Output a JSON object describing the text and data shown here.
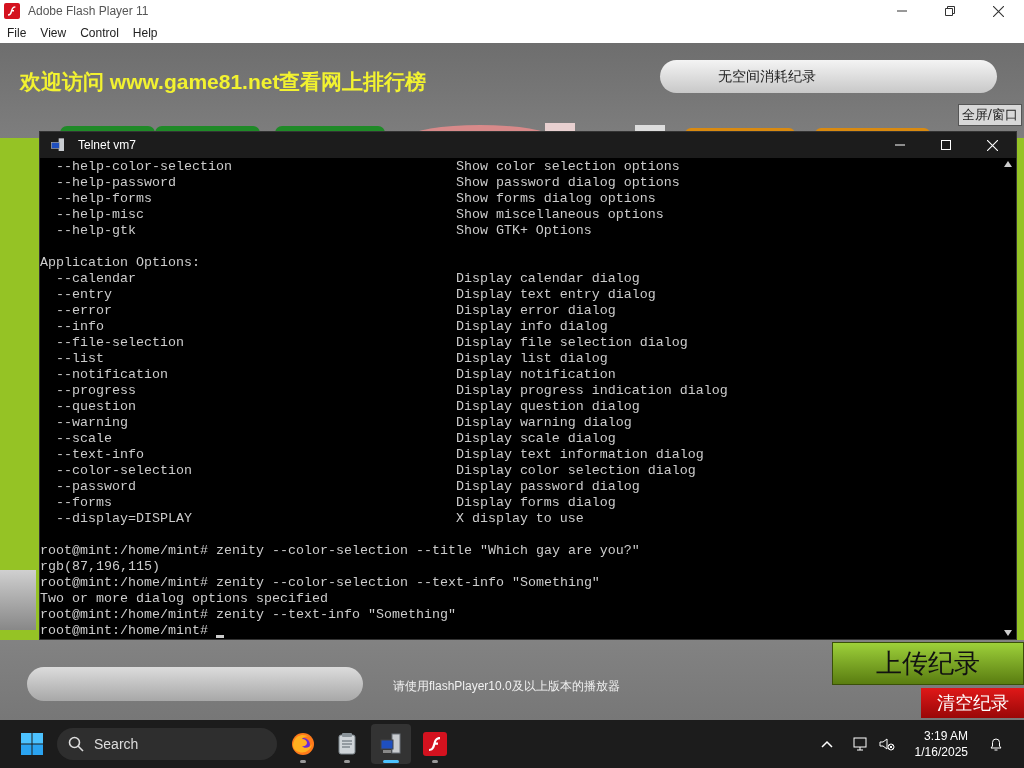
{
  "app_window": {
    "title": "Adobe Flash Player 11",
    "menu": [
      "File",
      "View",
      "Control",
      "Help"
    ]
  },
  "game": {
    "banner": "欢迎访问 www.game81.net查看网上排行榜",
    "record_field": "无空间消耗纪录",
    "fullscreen_button": "全屏/窗口",
    "notice": "请使用flashPlayer10.0及以上版本的播放器",
    "upload_button": "上传纪录",
    "clear_button": "清空纪录"
  },
  "terminal": {
    "title": "Telnet vm7",
    "lines": [
      {
        "kind": "option",
        "option": "--help-color-selection",
        "description": "Show color selection options"
      },
      {
        "kind": "option",
        "option": "--help-password",
        "description": "Show password dialog options"
      },
      {
        "kind": "option",
        "option": "--help-forms",
        "description": "Show forms dialog options"
      },
      {
        "kind": "option",
        "option": "--help-misc",
        "description": "Show miscellaneous options"
      },
      {
        "kind": "option",
        "option": "--help-gtk",
        "description": "Show GTK+ Options"
      },
      {
        "kind": "blank"
      },
      {
        "kind": "text",
        "text": "Application Options:"
      },
      {
        "kind": "option",
        "option": "--calendar",
        "description": "Display calendar dialog"
      },
      {
        "kind": "option",
        "option": "--entry",
        "description": "Display text entry dialog"
      },
      {
        "kind": "option",
        "option": "--error",
        "description": "Display error dialog"
      },
      {
        "kind": "option",
        "option": "--info",
        "description": "Display info dialog"
      },
      {
        "kind": "option",
        "option": "--file-selection",
        "description": "Display file selection dialog"
      },
      {
        "kind": "option",
        "option": "--list",
        "description": "Display list dialog"
      },
      {
        "kind": "option",
        "option": "--notification",
        "description": "Display notification"
      },
      {
        "kind": "option",
        "option": "--progress",
        "description": "Display progress indication dialog"
      },
      {
        "kind": "option",
        "option": "--question",
        "description": "Display question dialog"
      },
      {
        "kind": "option",
        "option": "--warning",
        "description": "Display warning dialog"
      },
      {
        "kind": "option",
        "option": "--scale",
        "description": "Display scale dialog"
      },
      {
        "kind": "option",
        "option": "--text-info",
        "description": "Display text information dialog"
      },
      {
        "kind": "option",
        "option": "--color-selection",
        "description": "Display color selection dialog"
      },
      {
        "kind": "option",
        "option": "--password",
        "description": "Display password dialog"
      },
      {
        "kind": "option",
        "option": "--forms",
        "description": "Display forms dialog"
      },
      {
        "kind": "option",
        "option": "--display=DISPLAY",
        "description": "X display to use"
      },
      {
        "kind": "blank"
      },
      {
        "kind": "text",
        "text": "root@mint:/home/mint# zenity --color-selection --title \"Which gay are you?\""
      },
      {
        "kind": "text",
        "text": "rgb(87,196,115)"
      },
      {
        "kind": "text",
        "text": "root@mint:/home/mint# zenity --color-selection --text-info \"Something\""
      },
      {
        "kind": "text",
        "text": "Two or more dialog options specified"
      },
      {
        "kind": "text",
        "text": "root@mint:/home/mint# zenity --text-info \"Something\""
      },
      {
        "kind": "prompt",
        "text": "root@mint:/home/mint#"
      }
    ]
  },
  "taskbar": {
    "search_placeholder": "Search",
    "apps": [
      {
        "kind": "firefox",
        "selected": false
      },
      {
        "kind": "files",
        "selected": false
      },
      {
        "kind": "telnet",
        "selected": true
      },
      {
        "kind": "flash",
        "selected": false
      }
    ],
    "time": "3:19 AM",
    "date": "1/16/2025"
  }
}
